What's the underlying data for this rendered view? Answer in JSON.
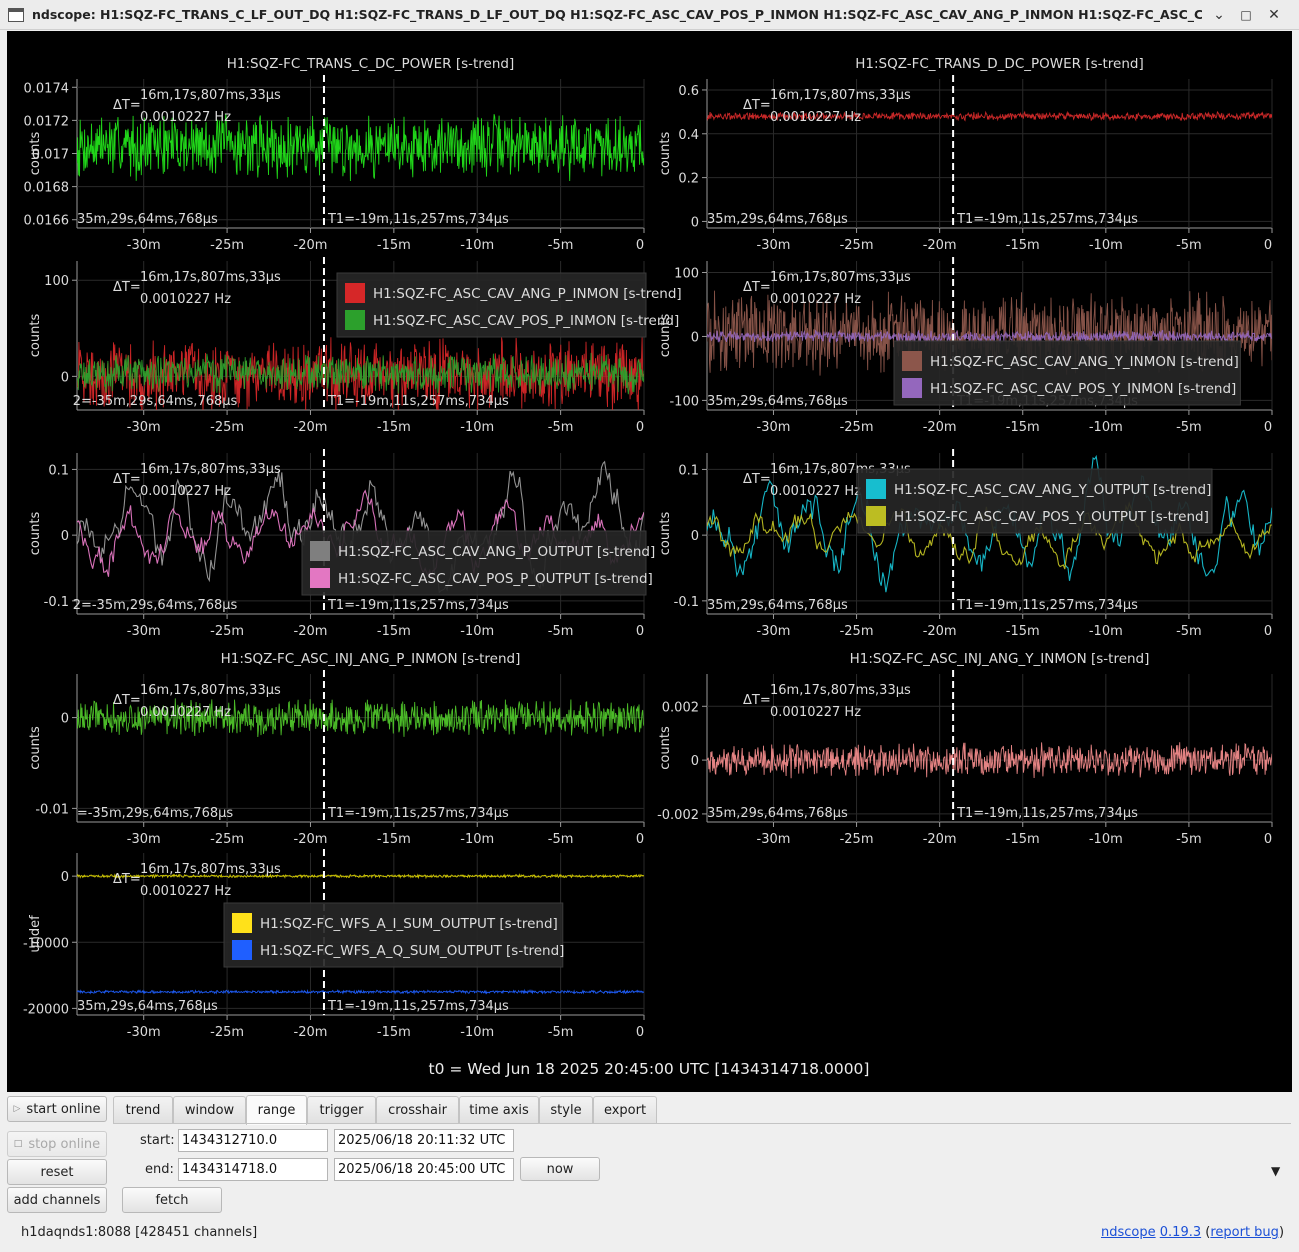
{
  "window": {
    "title": "ndscope: H1:SQZ-FC_TRANS_C_LF_OUT_DQ H1:SQZ-FC_TRANS_D_LF_OUT_DQ H1:SQZ-FC_ASC_CAV_POS_P_INMON H1:SQZ-FC_ASC_CAV_ANG_P_INMON H1:SQZ-FC_ASC_CAV_POS_Y_INMON H1:SQZ-FC_A",
    "minimize": "⌄",
    "maximize": "□",
    "close": "✕"
  },
  "cursors": {
    "delta_label": "ΔT=",
    "delta_value": "16m,17s,807ms,33µs",
    "freq": "0.0010227 Hz",
    "t1": "T1=-19m,11s,257ms,734µs",
    "t2_full": "T2=-35m,29s,64ms,768µs"
  },
  "time_ticks": [
    "-30m",
    "-25m",
    "-20m",
    "-15m",
    "-10m",
    "-5m",
    "0"
  ],
  "time_range_min": [
    -34,
    0
  ],
  "t1_min": -19.19,
  "t2_min": -35.48,
  "t0_label": "t0 = Wed Jun 18 2025 20:45:00 UTC [1434314718.0000]",
  "plots": [
    {
      "id": "p1",
      "col": 0,
      "row": 0,
      "title": "H1:SQZ-FC_TRANS_C_DC_POWER [s-trend]",
      "ylabel": "counts",
      "ymin": 0.01655,
      "ymax": 0.01745,
      "yticks": [
        0.0166,
        0.0168,
        0.017,
        0.0172,
        0.0174
      ],
      "ytick_labels": [
        "0.0166",
        "0.0168",
        "0.017",
        "0.0172",
        "0.0174"
      ],
      "t2_text": "35m,29s,64ms,768µs",
      "legend": [],
      "series": [
        {
          "color": "#22e01a",
          "base": 0.01705,
          "amp": 0.00022,
          "kind": "noise"
        }
      ]
    },
    {
      "id": "p2",
      "col": 1,
      "row": 0,
      "title": "H1:SQZ-FC_TRANS_D_DC_POWER [s-trend]",
      "ylabel": "counts",
      "ymin": -0.03,
      "ymax": 0.65,
      "yticks": [
        0,
        0.2,
        0.4,
        0.6
      ],
      "ytick_labels": [
        "0",
        "0.2",
        "0.4",
        "0.6"
      ],
      "t2_text": "35m,29s,64ms,768µs",
      "legend": [],
      "series": [
        {
          "color": "#d42a2a",
          "base": 0.48,
          "amp": 0.02,
          "kind": "noise"
        }
      ]
    },
    {
      "id": "p3",
      "col": 0,
      "row": 1,
      "title": "",
      "ylabel": "counts",
      "ymin": -35,
      "ymax": 120,
      "yticks": [
        0,
        100
      ],
      "ytick_labels": [
        "0",
        "100"
      ],
      "t2_text": "2=-35m,29s,64ms,768µs",
      "legend": [
        {
          "color": "#d62728",
          "label": "H1:SQZ-FC_ASC_CAV_ANG_P_INMON [s-trend]"
        },
        {
          "color": "#2ca02c",
          "label": "H1:SQZ-FC_ASC_CAV_POS_P_INMON [s-trend]"
        }
      ],
      "series": [
        {
          "color": "#d62728",
          "base": 0,
          "amp": 42,
          "kind": "noise"
        },
        {
          "color": "#2ca02c",
          "base": 3,
          "amp": 22,
          "kind": "noise"
        }
      ]
    },
    {
      "id": "p4",
      "col": 1,
      "row": 1,
      "title": "",
      "ylabel": "counts",
      "ymin": -115,
      "ymax": 118,
      "yticks": [
        -100,
        0,
        100
      ],
      "ytick_labels": [
        "-100",
        "0",
        "100"
      ],
      "t2_text": "35m,29s,64ms,768µs",
      "legend": [
        {
          "color": "#8c564b",
          "label": "H1:SQZ-FC_ASC_CAV_ANG_Y_INMON [s-trend]"
        },
        {
          "color": "#9467bd",
          "label": "H1:SQZ-FC_ASC_CAV_POS_Y_INMON [s-trend]"
        }
      ],
      "series": [
        {
          "color": "#8c564b",
          "base": 5,
          "amp": 70,
          "kind": "noise"
        },
        {
          "color": "#9467bd",
          "base": 0,
          "amp": 10,
          "kind": "noise"
        }
      ]
    },
    {
      "id": "p5",
      "col": 0,
      "row": 2,
      "title": "",
      "ylabel": "counts",
      "ymin": -0.12,
      "ymax": 0.125,
      "yticks": [
        -0.1,
        0,
        0.1
      ],
      "ytick_labels": [
        "-0.1",
        "0",
        "0.1"
      ],
      "t2_text": "2=-35m,29s,64ms,768µs",
      "legend": [
        {
          "color": "#7f7f7f",
          "label": "H1:SQZ-FC_ASC_CAV_ANG_P_OUTPUT [s-trend]"
        },
        {
          "color": "#e377c2",
          "label": "H1:SQZ-FC_ASC_CAV_POS_P_OUTPUT [s-trend]"
        }
      ],
      "series": [
        {
          "color": "#9a9a9a",
          "base": 0,
          "amp": 0.07,
          "kind": "wave"
        },
        {
          "color": "#e377c2",
          "base": 0,
          "amp": 0.05,
          "kind": "wave"
        }
      ]
    },
    {
      "id": "p6",
      "col": 1,
      "row": 2,
      "title": "",
      "ylabel": "counts",
      "ymin": -0.12,
      "ymax": 0.125,
      "yticks": [
        -0.1,
        0,
        0.1
      ],
      "ytick_labels": [
        "-0.1",
        "0",
        "0.1"
      ],
      "t2_text": "35m,29s,64ms,768µs",
      "legend": [
        {
          "color": "#17becf",
          "label": "H1:SQZ-FC_ASC_CAV_ANG_Y_OUTPUT [s-trend]"
        },
        {
          "color": "#bcbd22",
          "label": "H1:SQZ-FC_ASC_CAV_POS_Y_OUTPUT [s-trend]"
        }
      ],
      "series": [
        {
          "color": "#17becf",
          "base": 0,
          "amp": 0.065,
          "kind": "wave"
        },
        {
          "color": "#bcbd22",
          "base": 0,
          "amp": 0.04,
          "kind": "wave"
        }
      ]
    },
    {
      "id": "p7",
      "col": 0,
      "row": 3,
      "title": "H1:SQZ-FC_ASC_INJ_ANG_P_INMON [s-trend]",
      "ylabel": "counts",
      "ymin": -0.0115,
      "ymax": 0.0048,
      "yticks": [
        -0.01,
        0
      ],
      "ytick_labels": [
        "-0.01",
        "0"
      ],
      "t2_text": "=-35m,29s,64ms,768µs",
      "legend": [],
      "series": [
        {
          "color": "#4fc42a",
          "base": 0,
          "amp": 0.0022,
          "kind": "noise"
        }
      ]
    },
    {
      "id": "p8",
      "col": 1,
      "row": 3,
      "title": "H1:SQZ-FC_ASC_INJ_ANG_Y_INMON [s-trend]",
      "ylabel": "counts",
      "ymin": -0.0023,
      "ymax": 0.0032,
      "yticks": [
        -0.002,
        0,
        0.002
      ],
      "ytick_labels": [
        "-0.002",
        "0",
        "0.002"
      ],
      "t2_text": "35m,29s,64ms,768µs",
      "legend": [],
      "series": [
        {
          "color": "#f08a8a",
          "base": 0,
          "amp": 0.0007,
          "kind": "noise"
        }
      ]
    },
    {
      "id": "p9",
      "col": 0,
      "row": 4,
      "title": "",
      "ylabel": "undef",
      "ymin": -21000,
      "ymax": 3500,
      "yticks": [
        -20000,
        -10000,
        0
      ],
      "ytick_labels": [
        "-20000",
        "-10000",
        "0"
      ],
      "t2_text": "35m,29s,64ms,768µs",
      "legend": [
        {
          "color": "#ffe11a",
          "label": "H1:SQZ-FC_WFS_A_I_SUM_OUTPUT [s-trend]"
        },
        {
          "color": "#1f5fff",
          "label": "H1:SQZ-FC_WFS_A_Q_SUM_OUTPUT [s-trend]"
        }
      ],
      "series": [
        {
          "color": "#d8d000",
          "base": 0,
          "amp": 250,
          "kind": "noise"
        },
        {
          "color": "#1f5fff",
          "base": -17500,
          "amp": 250,
          "kind": "noise"
        }
      ]
    }
  ],
  "controls": {
    "start_online": "start online",
    "stop_online": "stop online",
    "reset": "reset",
    "add_channels": "add channels",
    "tabs": [
      "trend",
      "window",
      "range",
      "trigger",
      "crosshair",
      "time axis",
      "style",
      "export"
    ],
    "active_tab": "range",
    "start_label": "start:",
    "end_label": "end:",
    "start_gps": "1434312710.0",
    "start_utc": "2025/06/18 20:11:32 UTC",
    "end_gps": "1434314718.0",
    "end_utc": "2025/06/18 20:45:00 UTC",
    "now": "now",
    "fetch": "fetch",
    "expand_arrow": "▼"
  },
  "status": {
    "server": "h1daqnds1:8088  [428451 channels]",
    "app_name": "ndscope",
    "version": "0.19.3",
    "open_paren": " (",
    "report_bug": "report bug",
    "close_paren": ")"
  }
}
